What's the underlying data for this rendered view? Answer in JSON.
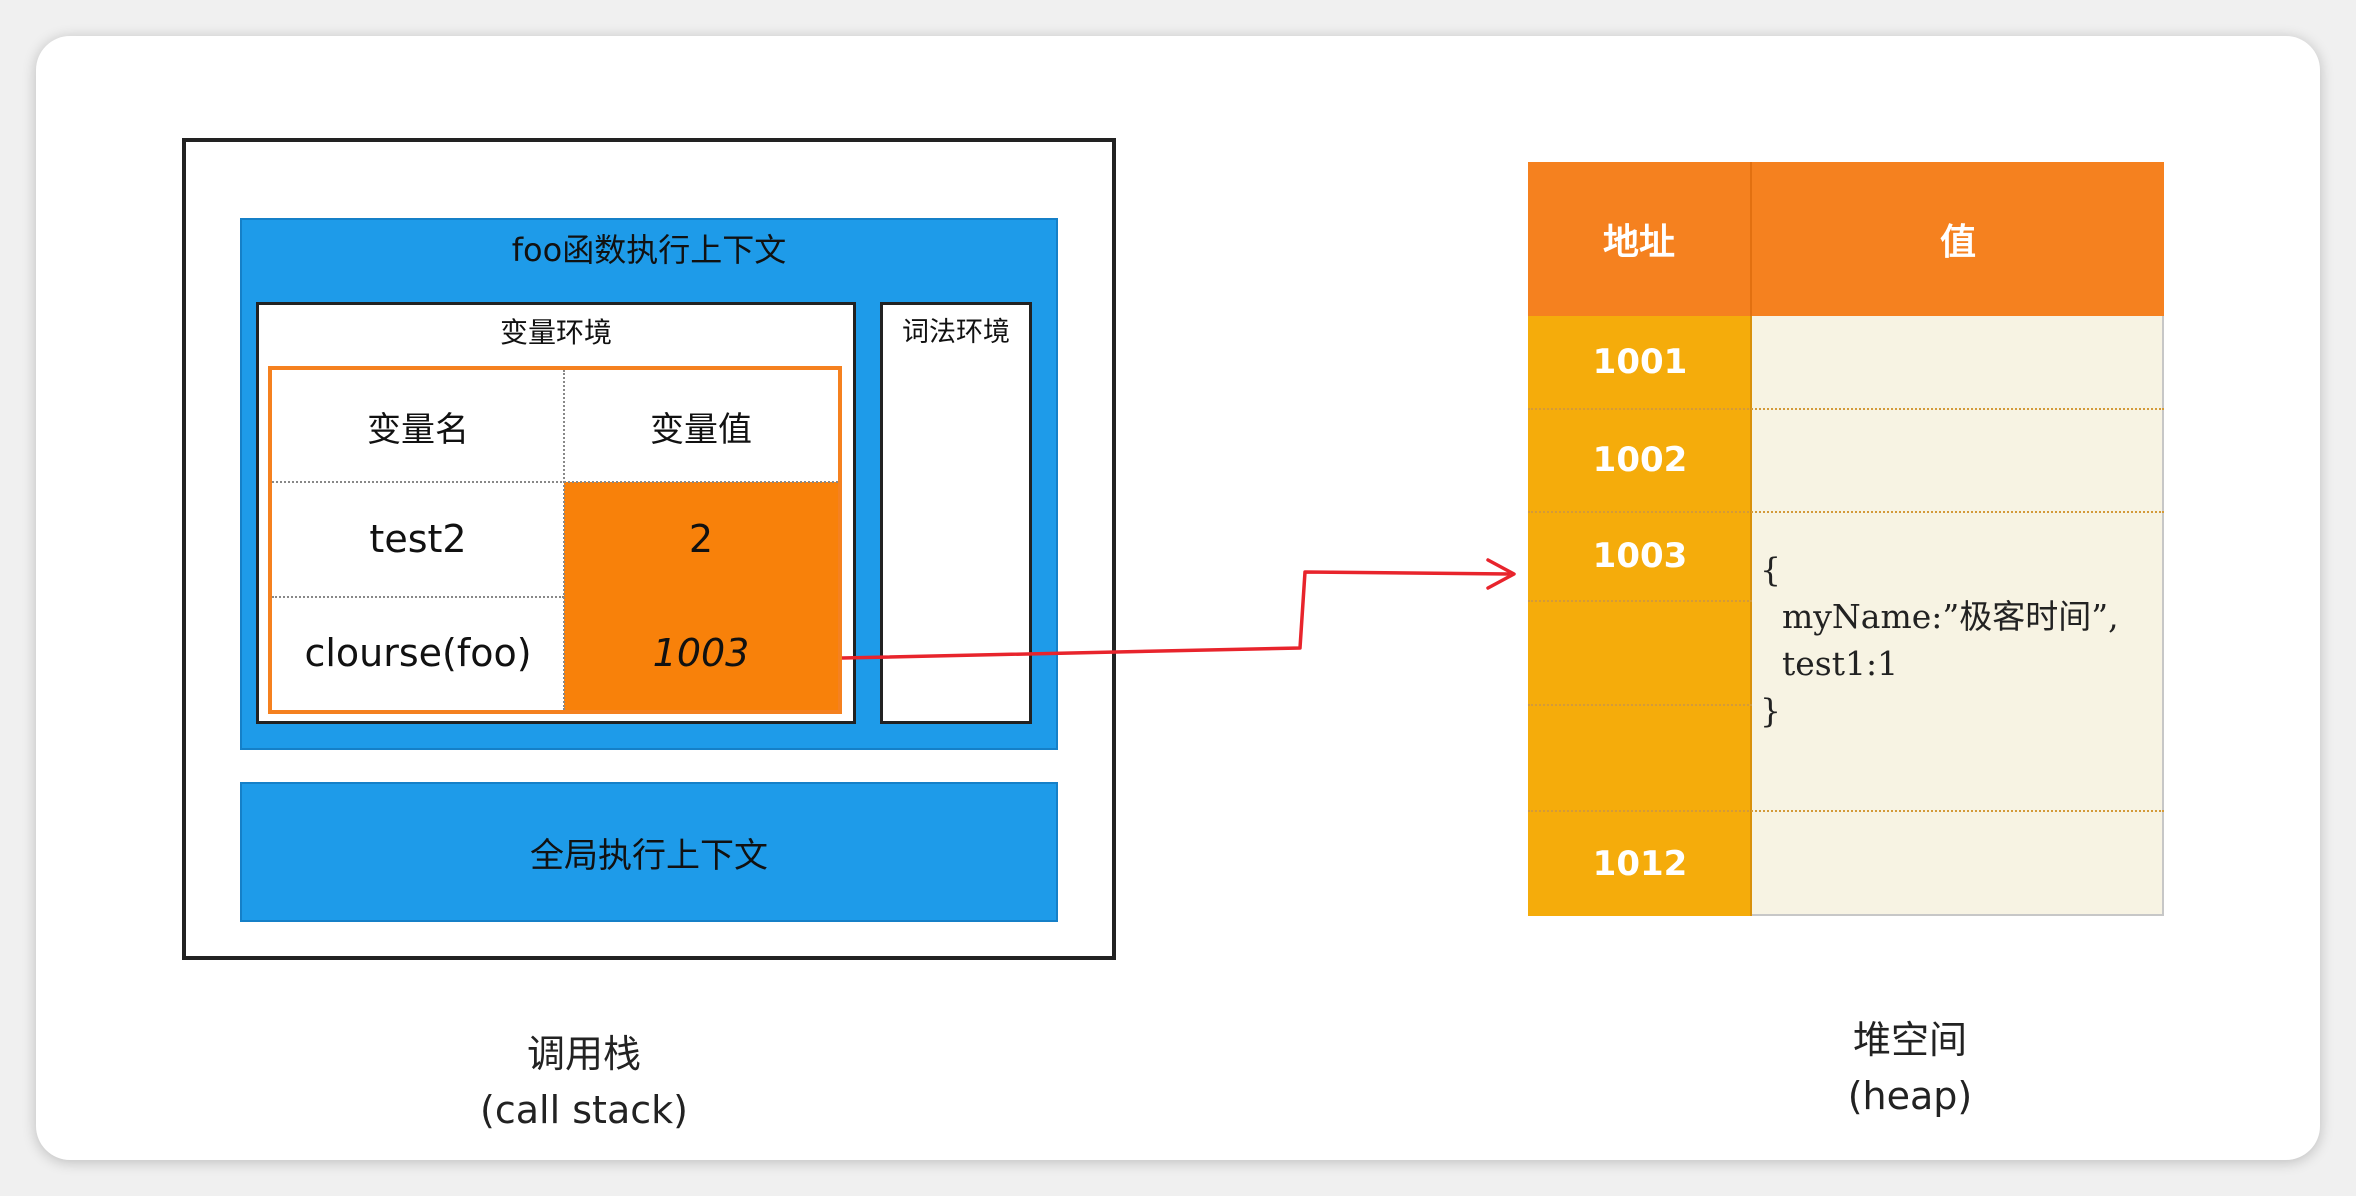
{
  "call_stack": {
    "foo_context_title": "foo函数执行上下文",
    "variable_env_title": "变量环境",
    "lexical_env_title": "词法环境",
    "table": {
      "headers": [
        "变量名",
        "变量值"
      ],
      "rows": [
        {
          "name": "test2",
          "value": "2"
        },
        {
          "name": "clourse(foo)",
          "value": "1003"
        }
      ]
    },
    "global_context_title": "全局执行上下文",
    "caption": "调用栈",
    "caption_en": "(call stack)"
  },
  "heap": {
    "headers": [
      "地址",
      "值"
    ],
    "addresses": [
      "1001",
      "1002",
      "1003",
      "1012"
    ],
    "value_lines": [
      "{",
      "myName:”极客时间”,",
      "test1:1",
      "}"
    ],
    "caption": "堆空间",
    "caption_en": "(heap)"
  },
  "colors": {
    "context_blue": "#1e9be9",
    "orange": "#f8810a",
    "heap_header": "#f5811f",
    "heap_address": "#f5ac0b",
    "heap_value_bg": "#f7f3e3",
    "pointer_arrow": "#e8242c"
  }
}
